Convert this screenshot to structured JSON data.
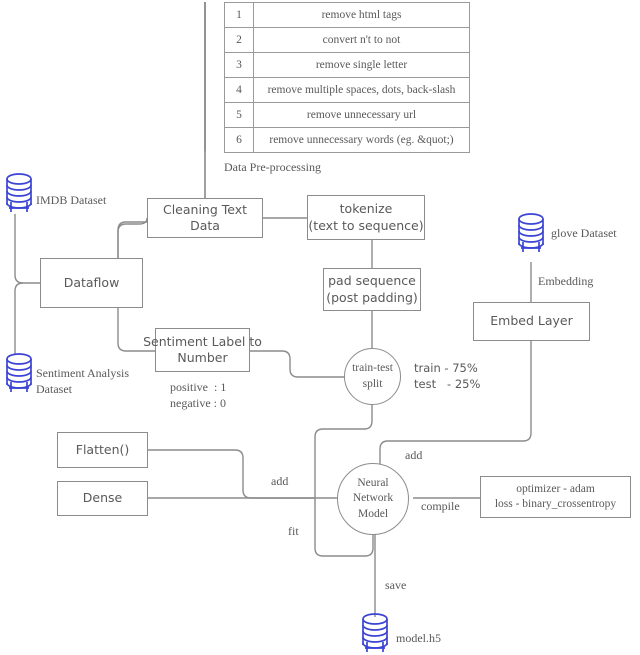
{
  "diagram": {
    "title": "Sentiment Analysis Model Dataflow Diagram",
    "colors": {
      "line": "#8c8c8c",
      "text": "#595959",
      "database": "#3b44d4",
      "background": "#ffffff"
    }
  },
  "preprocessing_table": {
    "caption": "Data Pre-processing",
    "rows": [
      {
        "num": "1",
        "text": "remove html tags"
      },
      {
        "num": "2",
        "text": "convert n't to not"
      },
      {
        "num": "3",
        "text": "remove single letter"
      },
      {
        "num": "4",
        "text": "remove multiple spaces, dots, back-slash"
      },
      {
        "num": "5",
        "text": "remove unnecessary url"
      },
      {
        "num": "6",
        "text": "remove unnecessary words (eg. &quot;)"
      }
    ]
  },
  "datastores": {
    "imdb": "IMDB Dataset",
    "sentiment": "Sentiment Analysis\nDataset",
    "glove": "glove Dataset",
    "model_file": "model.h5"
  },
  "nodes": {
    "cleaning": "Cleaning Text  Data",
    "dataflow": "Dataflow",
    "tokenize": "tokenize\n(text to sequence)",
    "pad_sequence": "pad sequence\n(post padding)",
    "sentiment_label": "Sentiment Label to\nNumber",
    "embed_layer": "Embed Layer",
    "train_test_split": "train-test\nsplit",
    "neural_network": "Neural\nNetwork\nModel",
    "flatten": "Flatten()",
    "dense": "Dense",
    "compile_params": "optimizer - adam\nloss - binary_crossentropy"
  },
  "edge_labels": {
    "embedding": "Embedding",
    "split_ratio": "train - 75%\ntest   - 25%",
    "label_mapping": "positive  : 1\nnegative : 0",
    "add_top": "add",
    "add_left": "add",
    "compile": "compile",
    "fit": "fit",
    "save": "save"
  }
}
